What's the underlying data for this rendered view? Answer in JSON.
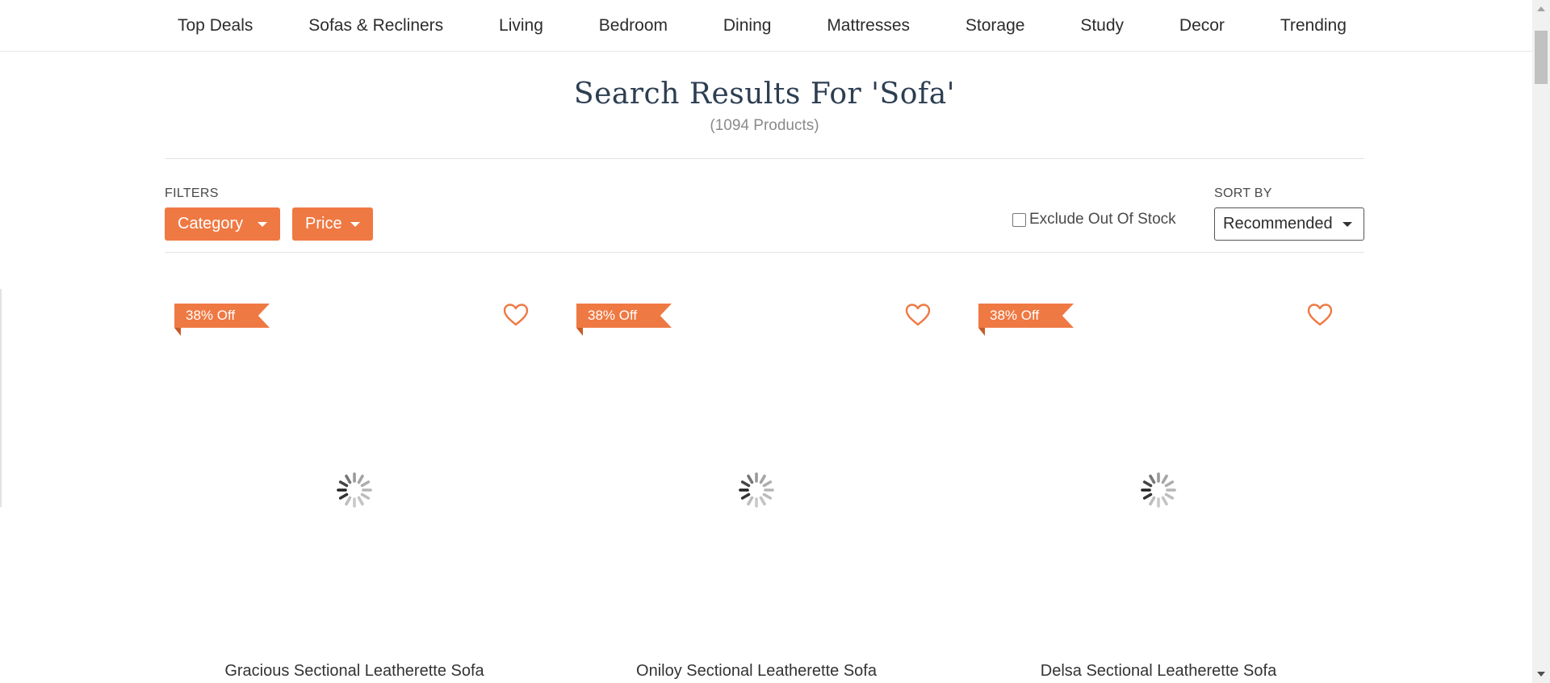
{
  "nav": {
    "items": [
      "Top Deals",
      "Sofas & Recliners",
      "Living",
      "Bedroom",
      "Dining",
      "Mattresses",
      "Storage",
      "Study",
      "Decor",
      "Trending"
    ]
  },
  "header": {
    "title": "Search Results For 'Sofa'",
    "count": "(1094 Products)"
  },
  "filters": {
    "label": "FILTERS",
    "buttons": [
      "Category",
      "Price"
    ]
  },
  "exclude_out_of_stock": {
    "label": "Exclude Out Of Stock",
    "checked": false
  },
  "sort": {
    "label": "SORT BY",
    "selected": "Recommended"
  },
  "products": [
    {
      "discount": "38% Off",
      "name": "Gracious Sectional Leatherette Sofa"
    },
    {
      "discount": "38% Off",
      "name": "Oniloy Sectional Leatherette Sofa"
    },
    {
      "discount": "38% Off",
      "name": "Delsa Sectional Leatherette Sofa"
    }
  ],
  "colors": {
    "accent": "#ef7943",
    "title": "#2d3e52"
  }
}
